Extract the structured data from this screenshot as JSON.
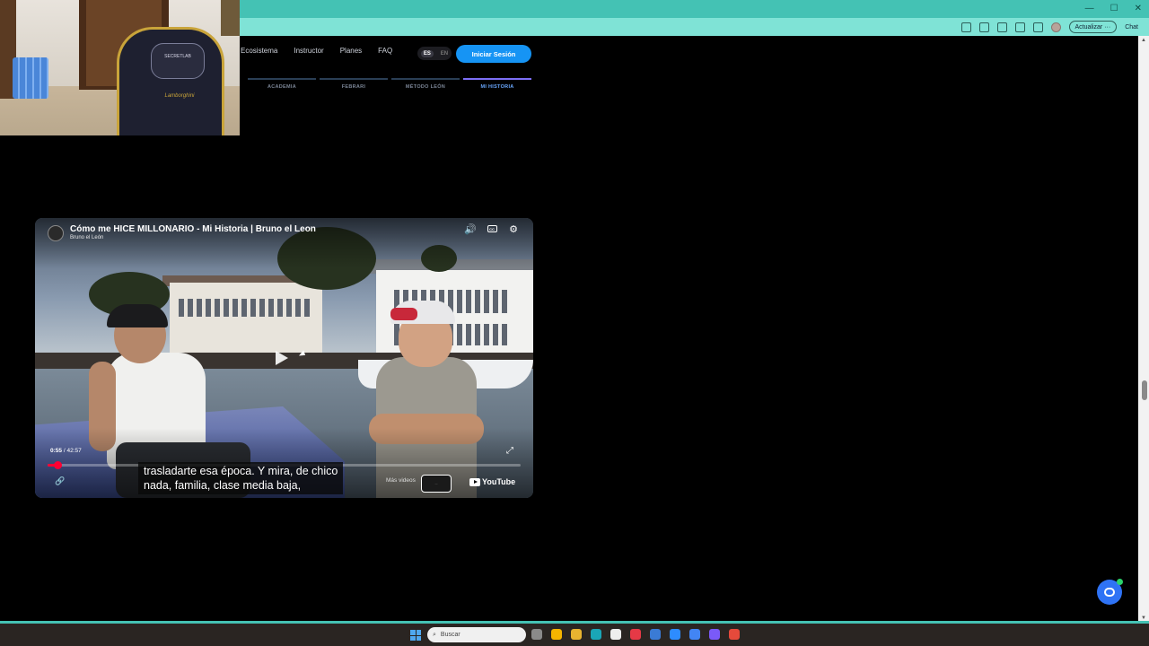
{
  "browser": {
    "update_label": "Actualizar",
    "chat_label": "Chat"
  },
  "site": {
    "nav": [
      "Ecosistema",
      "Instructor",
      "Planes",
      "FAQ"
    ],
    "lang_es": "ES",
    "lang_en": "EN",
    "login_label": "Iniciar Sesión",
    "tabs": [
      {
        "label": "ACADEMIA",
        "active": false
      },
      {
        "label": "FEBRARI",
        "active": false
      },
      {
        "label": "MÉTODO LEÓN",
        "active": false
      },
      {
        "label": "MI HISTORIA",
        "active": true
      }
    ]
  },
  "webcam": {
    "chair_logo": "SECRETLAB",
    "chair_brand": "Lamborghini"
  },
  "video": {
    "title": "Cómo me HICE MILLONARIO - Mi Historia | Bruno el Leon",
    "channel": "Bruno el León",
    "current_time": "0:55",
    "duration": "42:57",
    "progress_fraction": 0.0213,
    "subtitle_line1": "trasladarte esa época. Y mira, de chico",
    "subtitle_line2": "nada, familia, clase media baja,",
    "more_videos_label": "Más videos",
    "youtube_label": "YouTube",
    "cc_label": "CC"
  },
  "taskbar": {
    "search_placeholder": "Buscar",
    "app_colors": [
      "#8a8a8a",
      "#f4b400",
      "#e8b330",
      "#1aa6b7",
      "#eeeeee",
      "#e63946",
      "#3a7bd5",
      "#2d8cff",
      "#4285f4",
      "#7a5af8",
      "#e64a3b"
    ]
  }
}
